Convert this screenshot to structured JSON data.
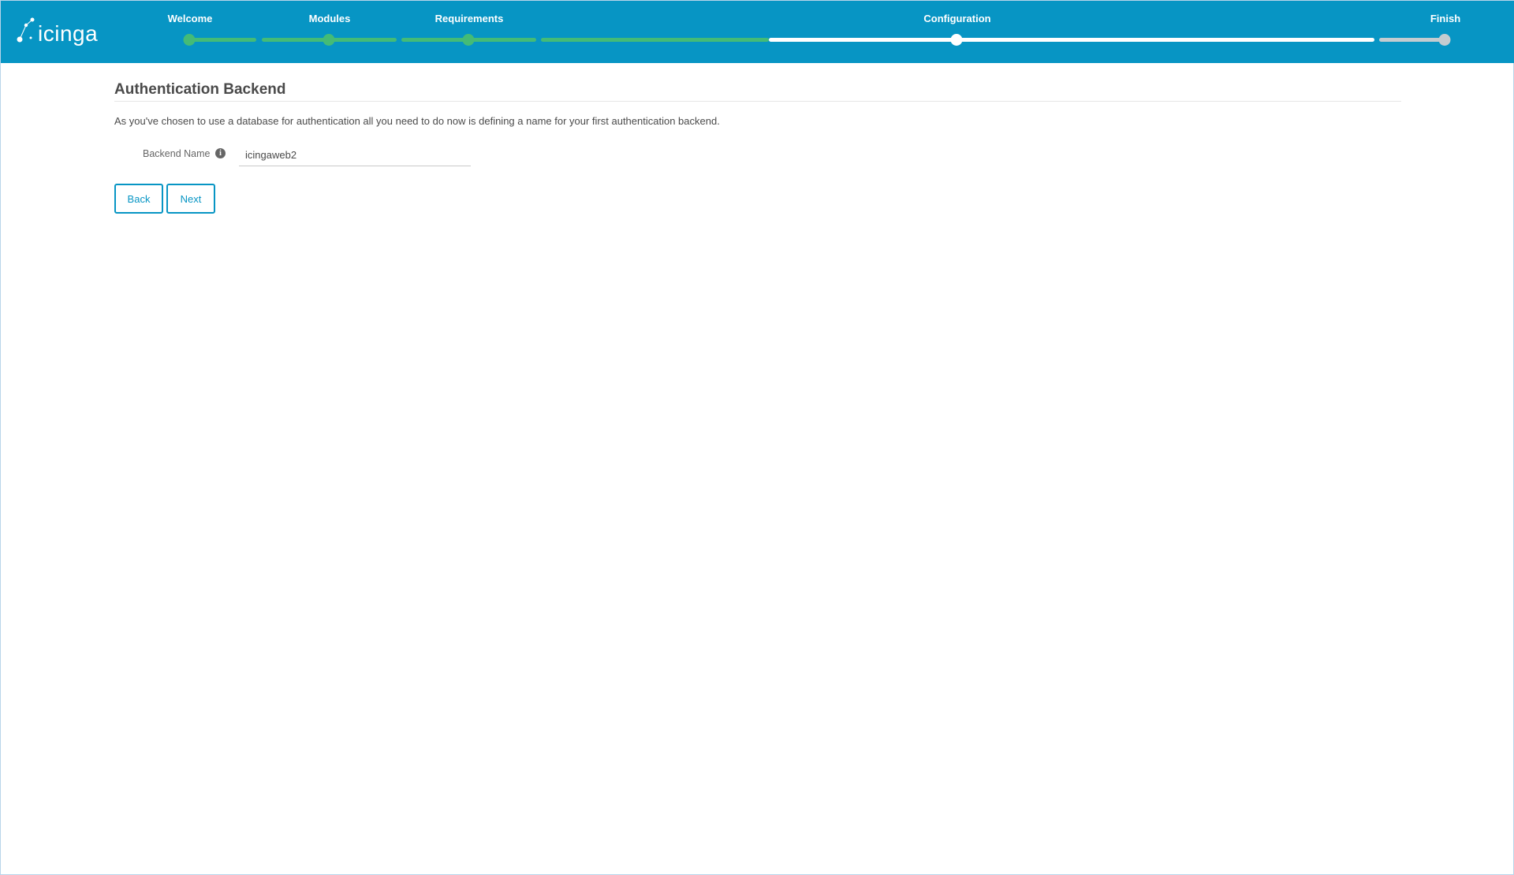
{
  "app": {
    "logo_text": "icinga",
    "colors": {
      "header": "#0795c4",
      "done": "#44bb77",
      "current": "#ffffff",
      "todo": "#c4ccd0",
      "accent": "#0795c4"
    }
  },
  "wizard": {
    "steps": [
      {
        "label": "Welcome",
        "state": "done"
      },
      {
        "label": "Modules",
        "state": "done"
      },
      {
        "label": "Requirements",
        "state": "done"
      },
      {
        "label": "Configuration",
        "state": "current"
      },
      {
        "label": "Finish",
        "state": "todo"
      }
    ]
  },
  "page": {
    "title": "Authentication Backend",
    "description": "As you've chosen to use a database for authentication all you need to do now is defining a name for your first authentication backend."
  },
  "form": {
    "backend_name_label": "Backend Name",
    "info_icon": "info-icon",
    "backend_name_value": "icingaweb2"
  },
  "actions": {
    "back_label": "Back",
    "next_label": "Next"
  }
}
